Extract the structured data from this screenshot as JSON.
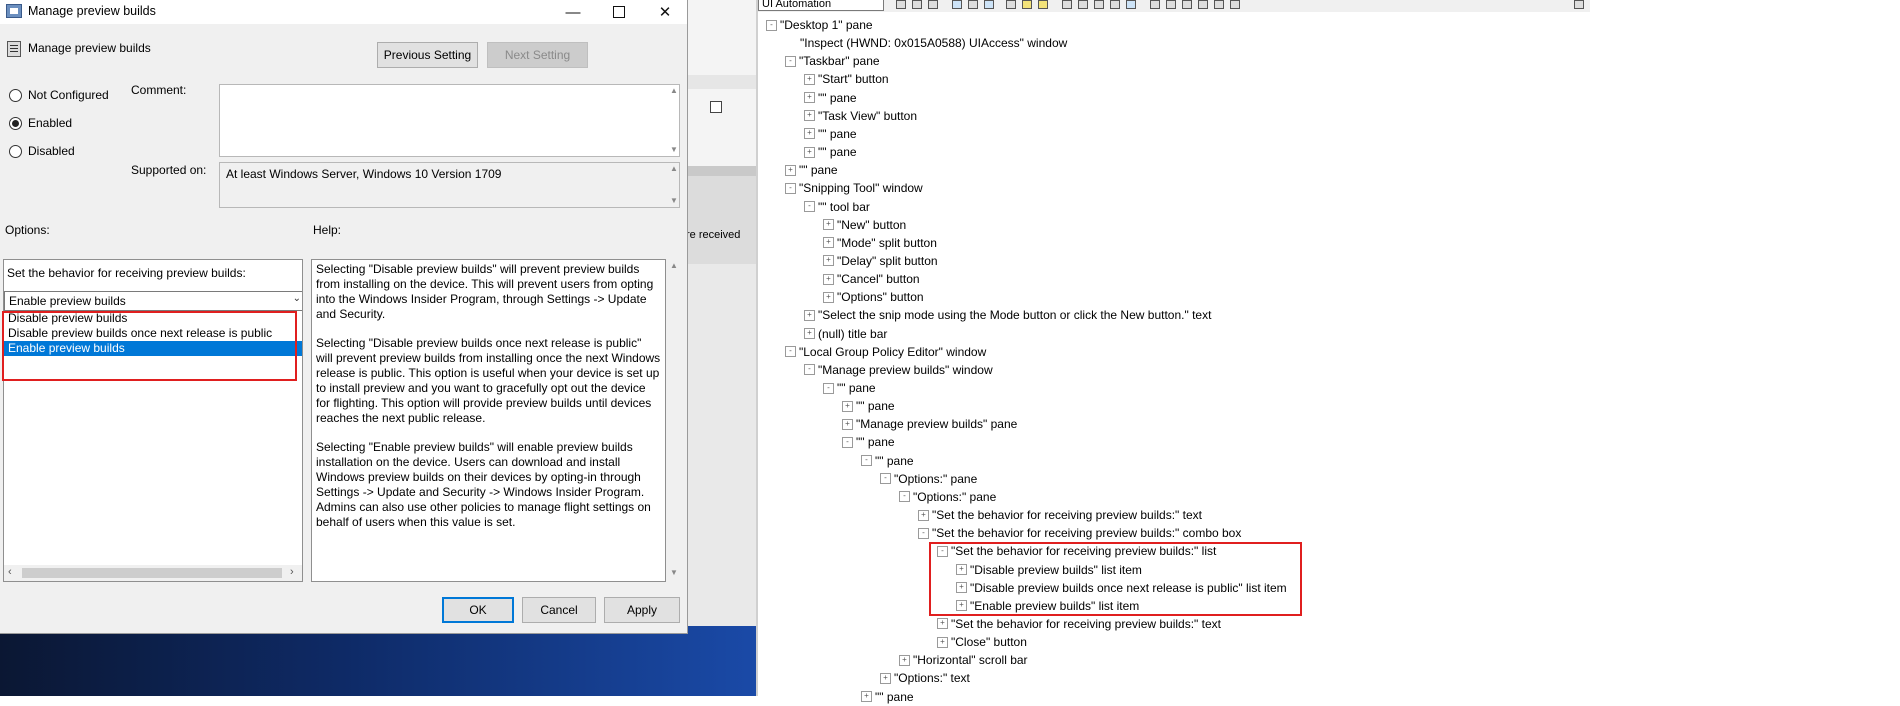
{
  "dialog": {
    "title": "Manage preview builds",
    "window_controls": {
      "minimize": "—",
      "close": "✕"
    },
    "header_title": "Manage preview builds",
    "prev_button": "Previous Setting",
    "next_button": "Next Setting",
    "radios": [
      {
        "label": "Not Configured",
        "checked": false
      },
      {
        "label": "Enabled",
        "checked": true
      },
      {
        "label": "Disabled",
        "checked": false
      }
    ],
    "comment_label": "Comment:",
    "comment_value": "",
    "supported_label": "Supported on:",
    "supported_value": "At least Windows Server, Windows 10 Version 1709",
    "options_label": "Options:",
    "help_label": "Help:",
    "options": {
      "prompt": "Set the behavior for receiving preview builds:",
      "selected": "Enable preview builds",
      "list": [
        "Disable preview builds",
        "Disable preview builds once next release is public",
        "Enable preview builds"
      ],
      "selected_index": 2
    },
    "help_paragraphs": [
      "Selecting \"Disable preview builds\" will prevent preview builds from installing on the device. This will prevent users from opting into the Windows Insider Program, through Settings -> Update and Security.",
      "Selecting \"Disable preview builds once next release is public\" will prevent preview builds from installing once the next Windows release is public. This option is useful when your device is set up to install preview and you want to gracefully opt out the device for flighting. This option will provide preview builds until devices reaches the next public release.",
      "Selecting \"Enable preview builds\" will enable preview builds installation on the device. Users can download and install Windows preview builds on their devices by opting-in through Settings -> Update and Security -> Windows Insider Program. Admins can also use other policies to manage flight settings on behalf of users when this value is set."
    ],
    "ok_button": "OK",
    "cancel_button": "Cancel",
    "apply_button": "Apply"
  },
  "background_window": {
    "partial_text": "re received"
  },
  "inspect": {
    "mode": "UI Automation",
    "tree": [
      {
        "text": "\"Desktop 1\" pane",
        "level": 0,
        "exp": "-"
      },
      {
        "text": "\"Inspect  (HWND: 0x015A0588) UIAccess\" window",
        "level": 1,
        "exp": ""
      },
      {
        "text": "\"Taskbar\" pane",
        "level": 1,
        "exp": "-"
      },
      {
        "text": "\"Start\" button",
        "level": 2,
        "exp": "+"
      },
      {
        "text": "\"\" pane",
        "level": 2,
        "exp": "+"
      },
      {
        "text": "\"Task View\" button",
        "level": 2,
        "exp": "+"
      },
      {
        "text": "\"\" pane",
        "level": 2,
        "exp": "+"
      },
      {
        "text": "\"\" pane",
        "level": 2,
        "exp": "+"
      },
      {
        "text": "\"\" pane",
        "level": 1,
        "exp": "+"
      },
      {
        "text": "\"Snipping Tool\" window",
        "level": 1,
        "exp": "-"
      },
      {
        "text": "\"\" tool bar",
        "level": 2,
        "exp": "-"
      },
      {
        "text": "\"New\" button",
        "level": 3,
        "exp": "+"
      },
      {
        "text": "\"Mode\" split button",
        "level": 3,
        "exp": "+"
      },
      {
        "text": "\"Delay\" split button",
        "level": 3,
        "exp": "+"
      },
      {
        "text": "\"Cancel\" button",
        "level": 3,
        "exp": "+"
      },
      {
        "text": "\"Options\" button",
        "level": 3,
        "exp": "+"
      },
      {
        "text": "\"Select the snip mode using the Mode button or click the New button.\" text",
        "level": 2,
        "exp": "+"
      },
      {
        "text": "(null) title bar",
        "level": 2,
        "exp": "+"
      },
      {
        "text": "\"Local Group Policy Editor\" window",
        "level": 1,
        "exp": "-"
      },
      {
        "text": "\"Manage preview builds\" window",
        "level": 2,
        "exp": "-"
      },
      {
        "text": "\"\" pane",
        "level": 3,
        "exp": "-"
      },
      {
        "text": "\"\" pane",
        "level": 4,
        "exp": "+"
      },
      {
        "text": "\"Manage preview builds\" pane",
        "level": 4,
        "exp": "+"
      },
      {
        "text": "\"\" pane",
        "level": 4,
        "exp": "-"
      },
      {
        "text": "\"\" pane",
        "level": 5,
        "exp": "-"
      },
      {
        "text": "\"Options:\" pane",
        "level": 6,
        "exp": "-"
      },
      {
        "text": "\"Options:\" pane",
        "level": 7,
        "exp": "-"
      },
      {
        "text": "\"Set the behavior for receiving preview builds:\" text",
        "level": 8,
        "exp": "+"
      },
      {
        "text": "\"Set the behavior for receiving preview builds:\" combo box",
        "level": 8,
        "exp": "-"
      },
      {
        "text": "\"Set the behavior for receiving preview builds:\" list",
        "level": 9,
        "exp": "-"
      },
      {
        "text": "\"Disable preview builds\" list item",
        "level": 10,
        "exp": "+"
      },
      {
        "text": "\"Disable preview builds once next release is public\" list item",
        "level": 10,
        "exp": "+"
      },
      {
        "text": "\"Enable preview builds\" list item",
        "level": 10,
        "exp": "+"
      },
      {
        "text": "\"Set the behavior for receiving preview builds:\" text",
        "level": 9,
        "exp": "+"
      },
      {
        "text": "\"Close\" button",
        "level": 9,
        "exp": "+"
      },
      {
        "text": "\"Horizontal\" scroll bar",
        "level": 7,
        "exp": "+"
      },
      {
        "text": "\"Options:\" text",
        "level": 6,
        "exp": "+"
      },
      {
        "text": "\"\" pane",
        "level": 5,
        "exp": "+"
      }
    ]
  },
  "colors": {
    "highlight": "#e01f1f",
    "selection": "#0078d7"
  }
}
